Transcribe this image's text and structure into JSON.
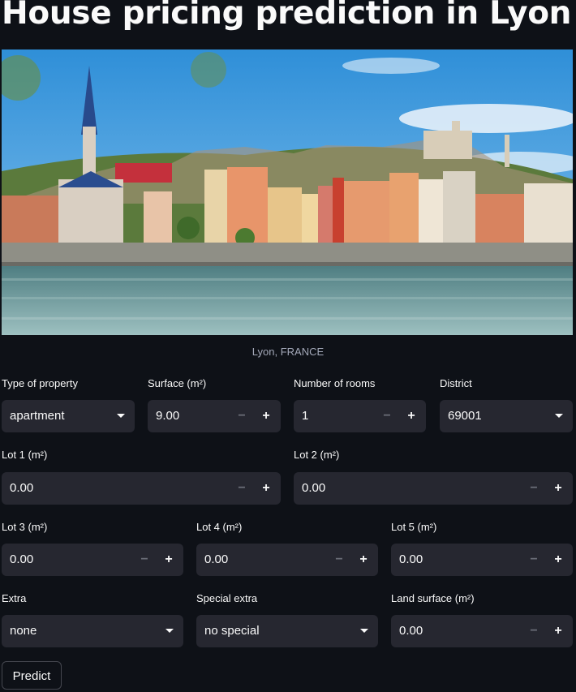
{
  "title": "House pricing prediction in Lyon",
  "image": {
    "caption": "Lyon, FRANCE",
    "icon": "lyon-cityscape-photo"
  },
  "fields": {
    "type_of_property": {
      "label": "Type of property",
      "value": "apartment"
    },
    "surface": {
      "label": "Surface (m²)",
      "value": "9.00"
    },
    "rooms": {
      "label": "Number of rooms",
      "value": "1"
    },
    "district": {
      "label": "District",
      "value": "69001"
    },
    "lot1": {
      "label": "Lot 1 (m²)",
      "value": "0.00"
    },
    "lot2": {
      "label": "Lot 2 (m²)",
      "value": "0.00"
    },
    "lot3": {
      "label": "Lot 3 (m²)",
      "value": "0.00"
    },
    "lot4": {
      "label": "Lot 4 (m²)",
      "value": "0.00"
    },
    "lot5": {
      "label": "Lot 5 (m²)",
      "value": "0.00"
    },
    "extra": {
      "label": "Extra",
      "value": "none"
    },
    "special_extra": {
      "label": "Special extra",
      "value": "no special"
    },
    "land_surface": {
      "label": "Land surface (m²)",
      "value": "0.00"
    }
  },
  "controls": {
    "minus": "−",
    "plus": "+"
  },
  "predict_label": "Predict",
  "colors": {
    "background": "#0e1117",
    "input": "#262730",
    "text": "#fafafa"
  }
}
